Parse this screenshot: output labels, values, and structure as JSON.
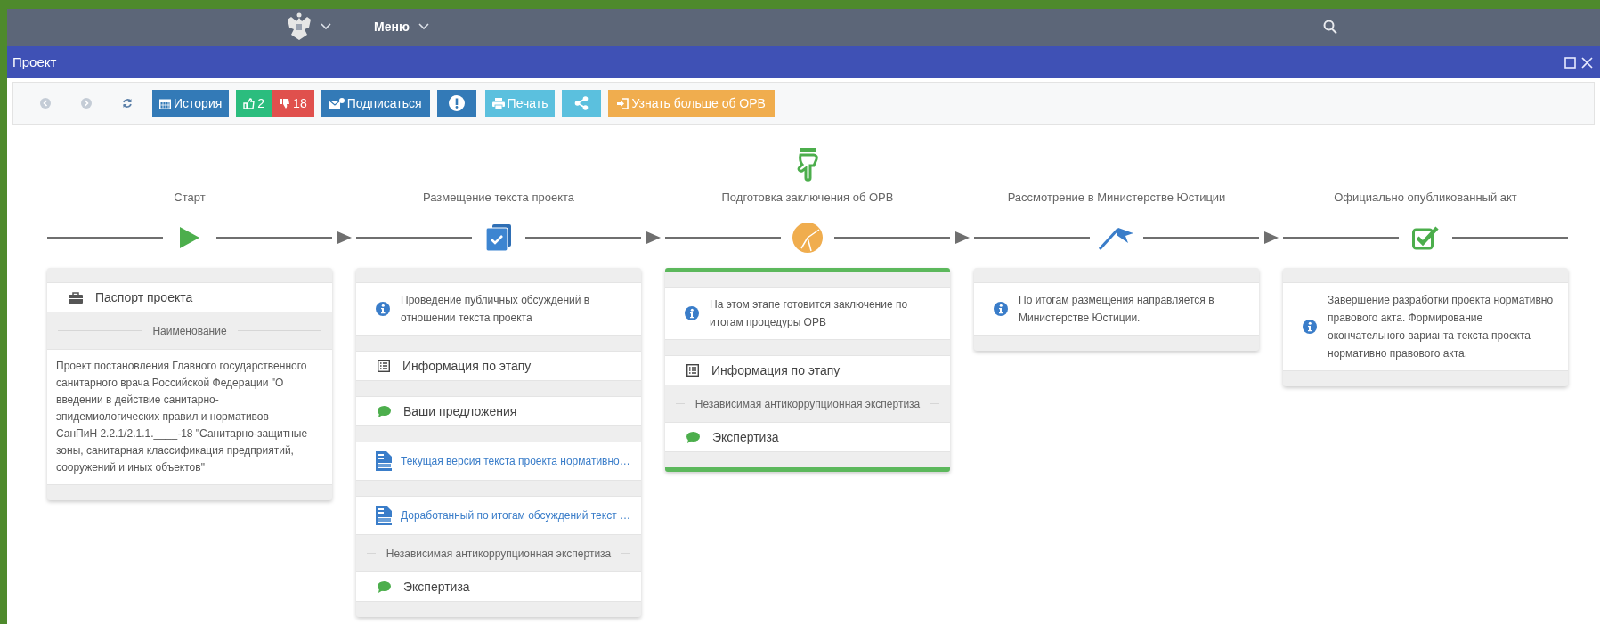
{
  "nav": {
    "menu_label": "Меню"
  },
  "window": {
    "title": "Проект"
  },
  "toolbar": {
    "buttons": [
      {
        "kind": "back"
      },
      {
        "kind": "forward"
      },
      {
        "kind": "refresh"
      },
      {
        "kind": "history",
        "label": "История"
      },
      {
        "kind": "like",
        "label": "2"
      },
      {
        "kind": "dislike",
        "label": "18"
      },
      {
        "kind": "subscribe",
        "label": "Подписаться"
      },
      {
        "kind": "report"
      },
      {
        "kind": "print",
        "label": "Печать"
      },
      {
        "kind": "share"
      },
      {
        "kind": "learn",
        "label": "Узнать больше об ОРВ"
      }
    ]
  },
  "stages": [
    {
      "title": "Старт",
      "kind": "play",
      "selected": false,
      "items": [
        {
          "kind": "passport",
          "label": "Паспорт проекта"
        },
        {
          "kind": "section",
          "label": "Наименование"
        },
        {
          "kind": "text",
          "text": "Проект постановления Главного государственного санитарного врача Российской Федерации \"О введении в действие санитарно-эпидемиологических правил и нормативов СанПиН 2.2.1/2.1.1.____-18 \"Санитарно-защитные зоны, санитарная классификация предприятий, сооружений и иных объектов\""
        }
      ]
    },
    {
      "title": "Размещение текста проекта",
      "kind": "document",
      "selected": false,
      "items": [
        {
          "kind": "info",
          "text": "Проведение публичных обсуждений в отношении текста проекта"
        },
        {
          "kind": "details",
          "label": "Информация по этапу"
        },
        {
          "kind": "comments",
          "label": "Ваши предложения"
        },
        {
          "kind": "doc",
          "label": "Текущая версия текста проекта нормативно…"
        },
        {
          "kind": "doc",
          "label": "Доработанный по итогам обсуждений текст …"
        },
        {
          "kind": "section",
          "label": "Независимая антикоррупционная экспертиза"
        },
        {
          "kind": "comments",
          "label": "Экспертиза"
        }
      ]
    },
    {
      "title": "Подготовка заключения об ОРВ",
      "kind": "pie",
      "selected": true,
      "items": [
        {
          "kind": "info",
          "text": "На этом этапе готовится заключение по итогам процедуры ОРВ"
        },
        {
          "kind": "details",
          "label": "Информация по этапу"
        },
        {
          "kind": "section",
          "label": "Независимая антикоррупционная экспертиза"
        },
        {
          "kind": "comments",
          "label": "Экспертиза"
        }
      ]
    },
    {
      "title": "Рассмотрение в Министерстве Юстиции",
      "kind": "flag",
      "selected": false,
      "items": [
        {
          "kind": "info",
          "text": "По итогам размещения направляется в Министерстве Юстиции."
        }
      ]
    },
    {
      "title": "Официально опубликованный акт",
      "kind": "checkbox",
      "selected": false,
      "items": [
        {
          "kind": "info",
          "text": "Завершение разработки проекта нормативно правового акта. Формирование окончательного варианта текста проекта нормативно правового акта."
        }
      ]
    }
  ]
}
